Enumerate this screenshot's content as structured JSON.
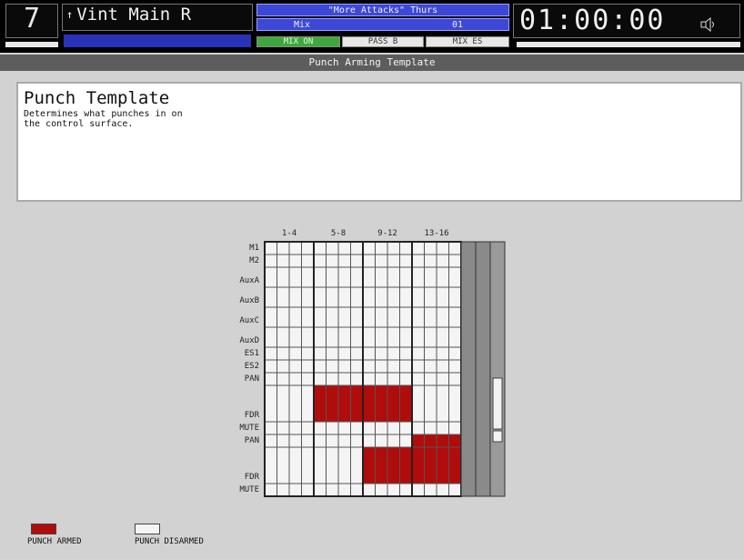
{
  "header": {
    "channel_number": "7",
    "track_name": "Vint Main R",
    "track_arrow": "↑",
    "blue_lines": [
      "\"More Attacks\" Thurs",
      "Mix",
      "01"
    ],
    "status_chips": [
      "MIX ON",
      "PASS B",
      "MIX ES"
    ],
    "timecode": "01:00:00",
    "timecode_icon": "speaker-icon"
  },
  "subtitle": "Punch Arming Template",
  "panel": {
    "title": "Punch Template",
    "description": "Determines what punches in on\nthe control surface."
  },
  "grid": {
    "column_groups": [
      "1-4",
      "5-8",
      "9-12",
      "13-16"
    ],
    "row_labels": [
      "M1",
      "M2",
      "AuxA",
      "AuxB",
      "AuxC",
      "AuxD",
      "ES1",
      "ES2",
      "PAN",
      "FDR",
      "MUTE",
      "PAN",
      "FDR",
      "MUTE"
    ]
  },
  "legend": {
    "armed_label": "PUNCH ARMED",
    "disarmed_label": "PUNCH DISARMED"
  },
  "colors": {
    "armed": "#b00c0c",
    "header_blue": "#3d48d6",
    "chip_green": "#3ea83e"
  }
}
